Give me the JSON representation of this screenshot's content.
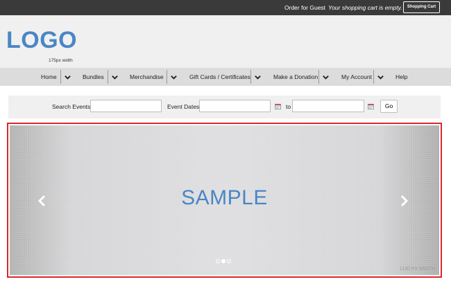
{
  "topbar": {
    "guest_label": "Order for Guest",
    "cart_message": "Your shopping cart is empty.",
    "cart_button": "Shopping Cart",
    "background": "#3a3a3a"
  },
  "header": {
    "logo_text": "LOGO",
    "logo_note": "175px width",
    "logo_color": "#4a86c5"
  },
  "nav": {
    "items": [
      {
        "label": "Home",
        "has_dropdown": true
      },
      {
        "label": "Bundles",
        "has_dropdown": true
      },
      {
        "label": "Merchandise",
        "has_dropdown": true
      },
      {
        "label": "Gift Cards / Certificates",
        "has_dropdown": true
      },
      {
        "label": "Make a Donation",
        "has_dropdown": true
      },
      {
        "label": "My Account",
        "has_dropdown": true
      },
      {
        "label": "Help",
        "has_dropdown": false
      }
    ],
    "dropdown_icon": "chevron-down-icon"
  },
  "search": {
    "events_label": "Search Events",
    "events_value": "",
    "dates_label": "Event Dates",
    "date_from_value": "",
    "to_label": "to",
    "date_to_value": "",
    "calendar_icon": "calendar-icon",
    "go_label": "Go"
  },
  "banner": {
    "sample_text": "SAMPLE",
    "width_note": "1130 PX WIDTH",
    "prev_icon": "chevron-left-icon",
    "next_icon": "chevron-right-icon",
    "slides": 3,
    "active_slide": 2,
    "border_color": "#d9262b"
  }
}
